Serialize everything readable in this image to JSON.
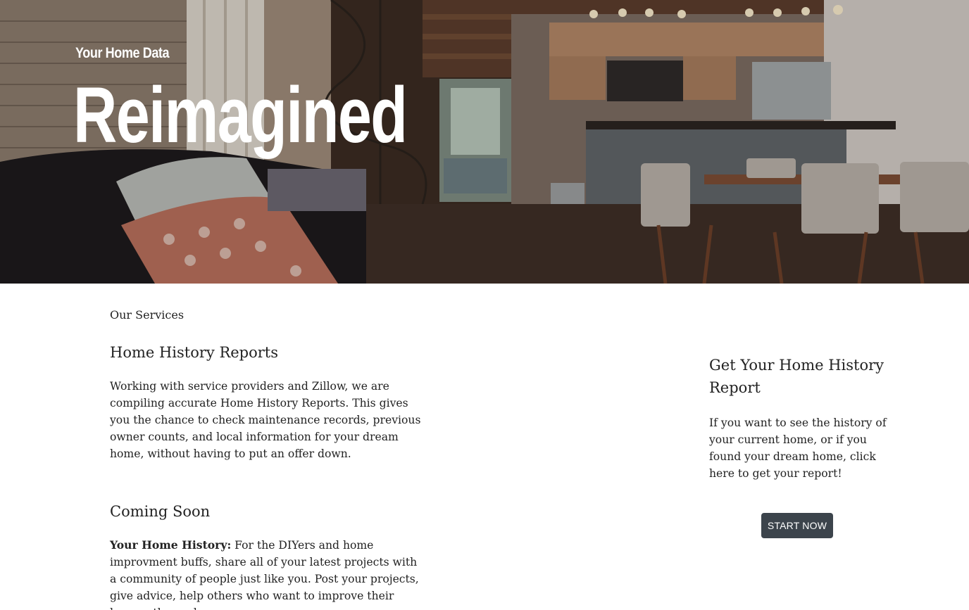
{
  "hero": {
    "kicker": "Your Home Data",
    "title": "Reimagined"
  },
  "services": {
    "label": "Our Services",
    "home_history": {
      "heading": "Home History Reports",
      "body": "Working with service providers and Zillow, we are compiling accurate Home History Reports. This gives you the chance to check maintenance records, previous owner counts, and local information for your dream home, without having to put an offer down."
    },
    "coming_soon": {
      "heading": "Coming Soon",
      "lead": "Your Home History:",
      "body": " For the DIYers and home improvment buffs, share all of your latest projects with a community of people just like you. Post your projects, give advice, help others who want to improve their homes, themselves."
    }
  },
  "cta": {
    "heading": "Get Your Home History Report",
    "body": "If you want to see the history of your current home, or if you found your dream home, click here to get your report!",
    "button_label": "START NOW",
    "button_color": "#3c444c"
  }
}
